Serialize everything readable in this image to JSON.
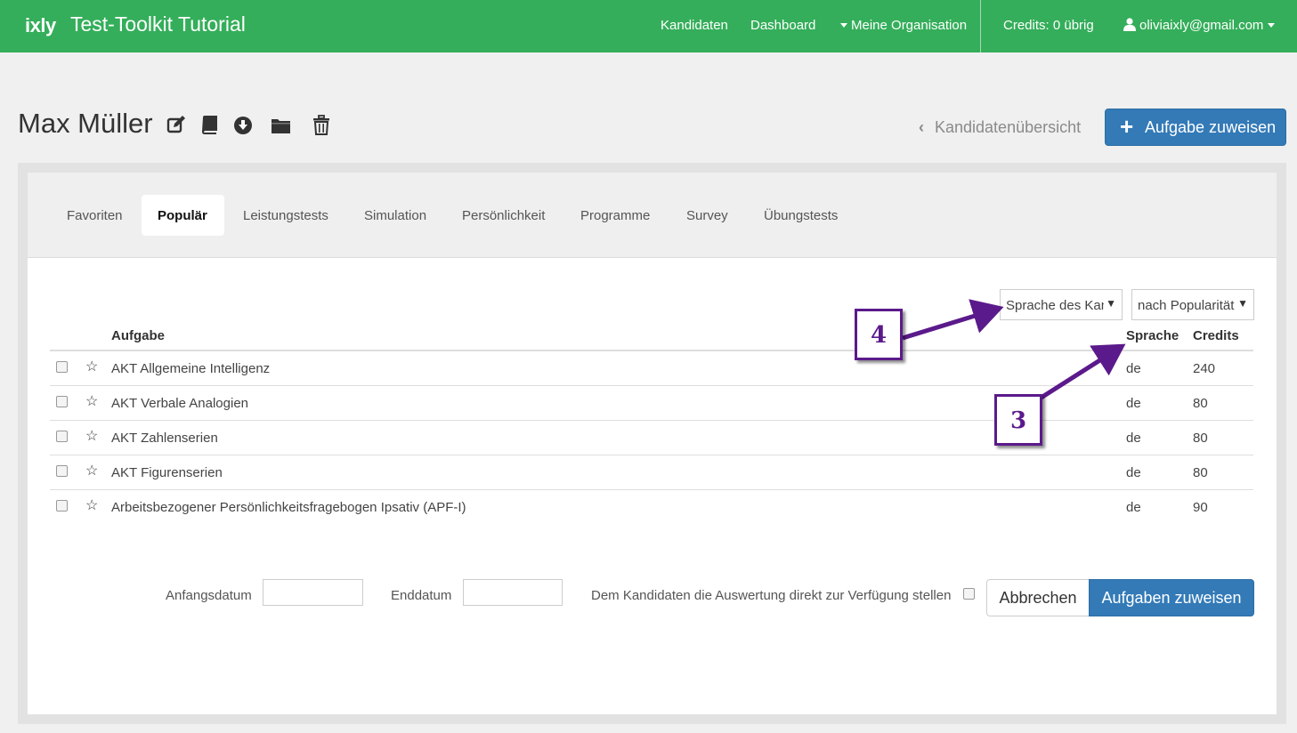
{
  "navbar": {
    "logo": "ixly",
    "title": "Test-Toolkit Tutorial",
    "links": [
      "Kandidaten",
      "Dashboard"
    ],
    "org_menu": "Meine Organisation",
    "credits": "Credits: 0 übrig",
    "user_email": "oliviaixly@gmail.com"
  },
  "header": {
    "candidate_name": "Max Müller",
    "icons": [
      "edit-icon",
      "book-icon",
      "download-icon",
      "folder-icon",
      "trash-icon"
    ],
    "back_link": "Kandidatenübersicht",
    "assign_button": "Aufgabe zuweisen"
  },
  "tabs": [
    {
      "label": "Favoriten",
      "active": false
    },
    {
      "label": "Populär",
      "active": true
    },
    {
      "label": "Leistungstests",
      "active": false
    },
    {
      "label": "Simulation",
      "active": false
    },
    {
      "label": "Persönlichkeit",
      "active": false
    },
    {
      "label": "Programme",
      "active": false
    },
    {
      "label": "Survey",
      "active": false
    },
    {
      "label": "Übungstests",
      "active": false
    }
  ],
  "filters": {
    "language_select": "Sprache des Kandidaten",
    "sort_select": "nach Popularität"
  },
  "table": {
    "headers": {
      "task": "Aufgabe",
      "language": "Sprache",
      "credits": "Credits"
    },
    "rows": [
      {
        "task": "AKT Allgemeine Intelligenz",
        "language": "de",
        "credits": "240"
      },
      {
        "task": "AKT Verbale Analogien",
        "language": "de",
        "credits": "80"
      },
      {
        "task": "AKT Zahlenserien",
        "language": "de",
        "credits": "80"
      },
      {
        "task": "AKT Figurenserien",
        "language": "de",
        "credits": "80"
      },
      {
        "task": "Arbeitsbezogener Persönlichkeitsfragebogen Ipsativ (APF-I)",
        "language": "de",
        "credits": "90"
      }
    ]
  },
  "form": {
    "start_label": "Anfangsdatum",
    "start_value": "",
    "end_label": "Enddatum",
    "end_value": "",
    "share_label": "Dem Kandidaten die Auswertung direkt zur Verfügung stellen",
    "cancel_button": "Abbrechen",
    "submit_button": "Aufgaben zuweisen"
  },
  "annotations": [
    {
      "number": "4",
      "target": "language-select"
    },
    {
      "number": "3",
      "target": "column-header-language"
    }
  ],
  "colors": {
    "navbar": "#34ae5a",
    "primary": "#337ab7",
    "callout": "#5b1a8b"
  }
}
